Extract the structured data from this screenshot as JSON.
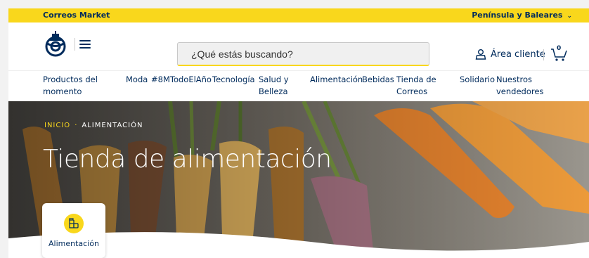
{
  "topbar": {
    "brand": "Correos Market",
    "region": "Península y Baleares",
    "region_icon": "chevron-down-icon"
  },
  "header": {
    "logo_icon": "correos-posthorn-logo",
    "menu_icon": "hamburger-icon",
    "search_placeholder": "¿Qué estás buscando?",
    "account_icon": "user-icon",
    "account_label": "Área cliente",
    "cart_icon": "cart-icon",
    "cart_count": "0"
  },
  "nav": {
    "items": [
      {
        "label": "Productos del",
        "label2": "momento"
      },
      {
        "label": "Moda",
        "label2": ""
      },
      {
        "label": "#8MTodoElAño",
        "label2": ""
      },
      {
        "label": "Tecnología",
        "label2": ""
      },
      {
        "label": "Salud y",
        "label2": "Belleza"
      },
      {
        "label": "Alimentación",
        "label2": ""
      },
      {
        "label": "Bebidas",
        "label2": ""
      },
      {
        "label": "Tienda de",
        "label2": "Correos"
      },
      {
        "label": "Solidario",
        "label2": ""
      },
      {
        "label": "Nuestros",
        "label2": "vendedores"
      }
    ]
  },
  "hero": {
    "breadcrumb_home": "INICIO",
    "breadcrumb_current": "ALIMENTACIÓN",
    "title": "Tienda de alimentación"
  },
  "category_card": {
    "icon": "grocery-bottle-icon",
    "label": "Alimentación"
  },
  "colors": {
    "brand_yellow": "#f9d71c",
    "brand_navy": "#002b5c"
  }
}
